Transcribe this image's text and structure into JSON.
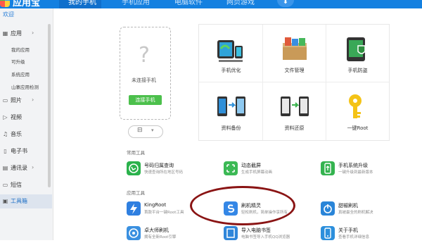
{
  "app": {
    "brand": "应用宝"
  },
  "tabs": [
    {
      "label": "我的手机",
      "active": true
    },
    {
      "label": "手机应用",
      "active": false
    },
    {
      "label": "电脑软件",
      "active": false
    },
    {
      "label": "网页游戏",
      "active": false
    }
  ],
  "download_icon": "⬇",
  "sidebar": {
    "welcome": "欢迎",
    "app_section": {
      "label": "应用",
      "arrow": "›"
    },
    "app_sub": [
      "我的应用",
      "可升级",
      "系统应用",
      "山寨应用检测"
    ],
    "items": [
      {
        "label": "照片",
        "arrow": "›",
        "icon": "photo-icon"
      },
      {
        "label": "视频",
        "arrow": "",
        "icon": "video-icon"
      },
      {
        "label": "音乐",
        "arrow": "",
        "icon": "music-icon"
      },
      {
        "label": "电子书",
        "arrow": "",
        "icon": "ebook-icon"
      },
      {
        "label": "通讯录",
        "arrow": "›",
        "icon": "contacts-icon"
      },
      {
        "label": "短信",
        "arrow": "",
        "icon": "sms-icon"
      },
      {
        "label": "工具箱",
        "arrow": "",
        "icon": "toolbox-icon",
        "active": true
      }
    ]
  },
  "connect": {
    "status": "未连接手机",
    "button": "连接手机",
    "icon": "?"
  },
  "grid": [
    {
      "label": "手机优化",
      "icon": "phone-optimize-icon"
    },
    {
      "label": "文件管理",
      "icon": "file-manager-icon"
    },
    {
      "label": "手机防盗",
      "icon": "anti-theft-icon"
    },
    {
      "label": "资料备份",
      "icon": "backup-icon"
    },
    {
      "label": "资料还原",
      "icon": "restore-icon"
    },
    {
      "label": "一键Root",
      "icon": "root-key-icon"
    }
  ],
  "sections": {
    "common": "常用工具",
    "apps": "应用工具"
  },
  "common_tools": [
    {
      "name": "号码归属查询",
      "desc": "快速查询所在地区号码",
      "icon": "phone-lookup-icon",
      "color": "#2bb24c"
    },
    {
      "name": "动态截屏",
      "desc": "生成手机屏幕动画",
      "icon": "screenshot-icon",
      "color": "#3cb955"
    },
    {
      "name": "手机系统升级",
      "desc": "一键升级到最新版本",
      "icon": "system-upgrade-icon",
      "color": "#34b34f"
    }
  ],
  "app_tools": [
    {
      "name": "KingRoot",
      "desc": "首款平台一键Root工具",
      "icon": "kingroot-icon",
      "color": "#2f7fe0"
    },
    {
      "name": "刷机精灵",
      "desc": "轻松刷机，简单操作享所有",
      "icon": "flash-icon",
      "color": "#3487e6"
    },
    {
      "name": "甜椒刷机",
      "desc": "真被最全的刷机解决",
      "icon": "tianjiao-icon",
      "color": "#2a85d8"
    },
    {
      "name": "卓大师刷机",
      "desc": "拥有全新Root引擎",
      "icon": "zhuodashi-icon",
      "color": "#3a90e0"
    },
    {
      "name": "导入电脑书签",
      "desc": "电脑书签导入手机QQ浏览器",
      "icon": "bookmark-import-icon",
      "color": "#2f86da"
    },
    {
      "name": "关于手机",
      "desc": "查看手机详细信息",
      "icon": "about-phone-icon",
      "color": "#2c8fdc"
    }
  ]
}
